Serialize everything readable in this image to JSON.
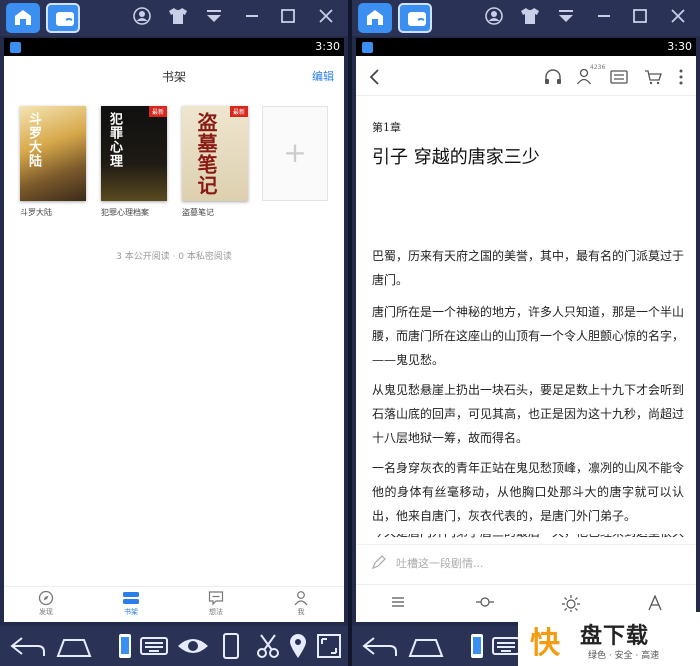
{
  "status_time": "3:30",
  "shelf": {
    "title": "书架",
    "edit": "编辑",
    "books": [
      {
        "title": "斗罗大陆",
        "cover_text": "斗罗大陆"
      },
      {
        "title": "犯罪心理档案",
        "cover_text": "犯罪心理",
        "badge": "最新"
      },
      {
        "title": "盗墓笔记",
        "cover_text": "盗墓笔记",
        "badge": "最新"
      }
    ],
    "add_symbol": "+",
    "count_text": "3 本公开阅读 · 0 本私密阅读"
  },
  "bottom_nav": [
    {
      "label": "发现",
      "icon": "compass-icon"
    },
    {
      "label": "书架",
      "icon": "bookshelf-icon"
    },
    {
      "label": "想法",
      "icon": "chat-icon"
    },
    {
      "label": "我",
      "icon": "person-icon"
    }
  ],
  "reader": {
    "badge_count": "4236",
    "chapter_no": "第1章",
    "chapter_title": "引子 穿越的唐家三少",
    "paragraphs": [
      "巴蜀，历来有天府之国的美誉，其中，最有名的门派莫过于唐门。",
      "唐门所在是一个神秘的地方，许多人只知道，那是一个半山腰，而唐门所在这座山的山顶有一个令人胆颤心惊的名字，——鬼见愁。",
      "从鬼见愁悬崖上扔出一块石头，要足足数上十九下才会听到石落山底的回声，可见其高，也正是因为这十九秒，尚超过十八层地狱一筹，故而得名。",
      "一名身穿灰衣的青年正站在鬼见愁顶峰，凛冽的山风不能令他的身体有丝毫移动，从他胸口处那斗大的唐字就可以认出，他来自唐门，灰衣代表的，是唐门外门弟子。"
    ],
    "partial_line": "今天是唐门外门弟子唐三的最后一天，他已经来到这里很久了",
    "comment_placeholder": "吐槽这一段剧情..."
  },
  "watermark": {
    "logo": "快",
    "title": "盘下载",
    "subtitle": "绿色 · 安全 · 高速"
  },
  "colors": {
    "accent": "#2b7de9",
    "emulator_bar": "#2a3256"
  }
}
